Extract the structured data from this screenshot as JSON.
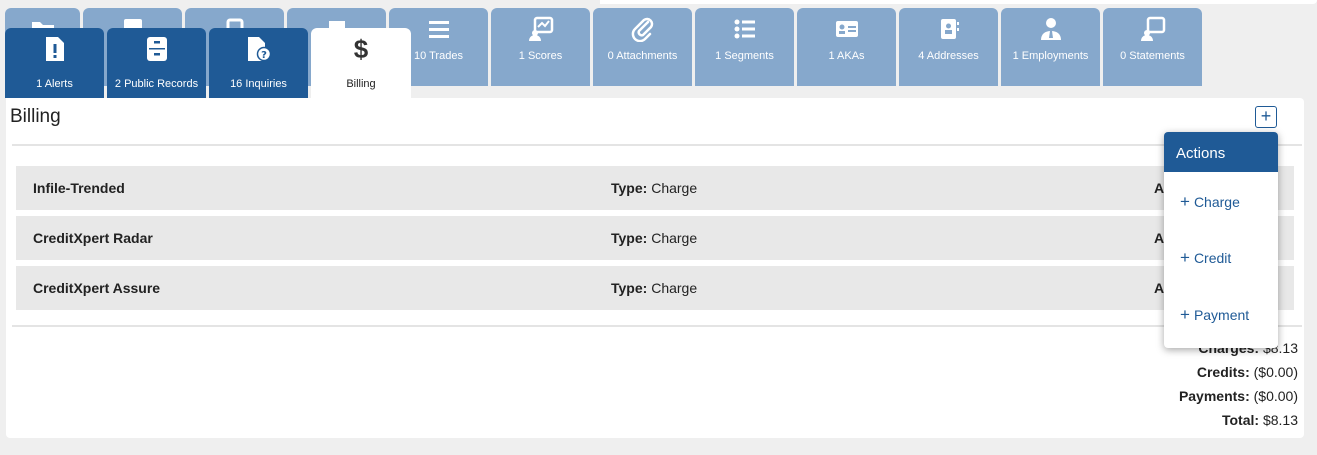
{
  "tabs_back": [
    {
      "label": "",
      "icon": "folder-icon"
    },
    {
      "label": "",
      "icon": "cabinet-icon"
    },
    {
      "label": "",
      "icon": "document-stack-icon"
    },
    {
      "label": "",
      "icon": "tag-icon"
    },
    {
      "label": "10 Trades",
      "icon": "list-lines-icon"
    },
    {
      "label": "1 Scores",
      "icon": "score-chart-icon"
    },
    {
      "label": "0 Attachments",
      "icon": "paperclip-icon"
    },
    {
      "label": "1 Segments",
      "icon": "bullet-list-icon"
    },
    {
      "label": "1 AKAs",
      "icon": "id-card-icon"
    },
    {
      "label": "4 Addresses",
      "icon": "address-book-icon"
    },
    {
      "label": "1 Employments",
      "icon": "employee-icon"
    },
    {
      "label": "0 Statements",
      "icon": "statement-icon"
    }
  ],
  "tabs_front": [
    {
      "label": "1 Alerts",
      "icon": "alert-document-icon"
    },
    {
      "label": "2 Public Records",
      "icon": "cabinet-icon"
    },
    {
      "label": "16 Inquiries",
      "icon": "inquiry-document-icon"
    }
  ],
  "active_tab": {
    "label": "Billing",
    "symbol": "$",
    "icon": "dollar-icon"
  },
  "panel": {
    "title": "Billing",
    "add_symbol": "+"
  },
  "rows": [
    {
      "name": "Infile-Trended",
      "type_label": "Type:",
      "type": "Charge",
      "amount_label": "Ar"
    },
    {
      "name": "CreditXpert Radar",
      "type_label": "Type:",
      "type": "Charge",
      "amount_label": "Ar"
    },
    {
      "name": "CreditXpert Assure",
      "type_label": "Type:",
      "type": "Charge",
      "amount_label": "Ar"
    }
  ],
  "summary": [
    {
      "label": "Charges:",
      "value": "$8.13"
    },
    {
      "label": "Credits:",
      "value": "($0.00)"
    },
    {
      "label": "Payments:",
      "value": "($0.00)"
    },
    {
      "label": "Total:",
      "value": "$8.13"
    }
  ],
  "actions_menu": {
    "header": "Actions",
    "items": [
      {
        "plus": "+",
        "label": "Charge"
      },
      {
        "plus": "+",
        "label": "Credit"
      },
      {
        "plus": "+",
        "label": "Payment"
      }
    ]
  },
  "colors": {
    "tab_back": "#86a8cc",
    "tab_front": "#1f5a96",
    "accent": "#1f5a96"
  }
}
